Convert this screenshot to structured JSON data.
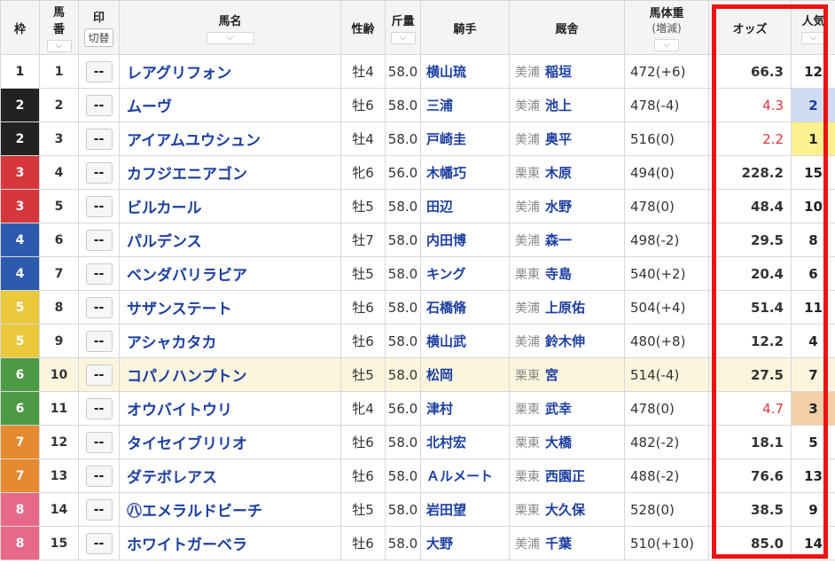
{
  "headers": {
    "waku": "枠",
    "umaban_l1": "馬",
    "umaban_l2": "番",
    "mark": "印",
    "mark_toggle": "切替",
    "name": "馬名",
    "sexage": "性齢",
    "kinryo": "斤量",
    "jockey": "騎手",
    "stable": "厩舎",
    "weight_l1": "馬体重",
    "weight_l2": "(増減)",
    "odds": "オッズ",
    "popularity": "人気"
  },
  "mark_placeholder": "--",
  "rows": [
    {
      "waku": "1",
      "umaban": "1",
      "name": "レアグリフォン",
      "sexage": "牡4",
      "kinryo": "58.0",
      "jockey": "横山琉",
      "region": "美浦",
      "trainer": "稲垣",
      "weight": "472(+6)",
      "odds": "66.3",
      "pop": "12"
    },
    {
      "waku": "2",
      "umaban": "2",
      "name": "ムーヴ",
      "sexage": "牡6",
      "kinryo": "58.0",
      "jockey": "三浦",
      "region": "美浦",
      "trainer": "池上",
      "weight": "478(-4)",
      "odds": "4.3",
      "pop": "2"
    },
    {
      "waku": "2",
      "umaban": "3",
      "name": "アイアムユウシュン",
      "sexage": "牡4",
      "kinryo": "58.0",
      "jockey": "戸崎圭",
      "region": "美浦",
      "trainer": "奥平",
      "weight": "516(0)",
      "odds": "2.2",
      "pop": "1"
    },
    {
      "waku": "3",
      "umaban": "4",
      "name": "カフジエニアゴン",
      "sexage": "牝6",
      "kinryo": "56.0",
      "jockey": "木幡巧",
      "region": "栗東",
      "trainer": "木原",
      "weight": "494(0)",
      "odds": "228.2",
      "pop": "15"
    },
    {
      "waku": "3",
      "umaban": "5",
      "name": "ビルカール",
      "sexage": "牡5",
      "kinryo": "58.0",
      "jockey": "田辺",
      "region": "美浦",
      "trainer": "水野",
      "weight": "478(0)",
      "odds": "48.4",
      "pop": "10"
    },
    {
      "waku": "4",
      "umaban": "6",
      "name": "パルデンス",
      "sexage": "牡7",
      "kinryo": "58.0",
      "jockey": "内田博",
      "region": "美浦",
      "trainer": "森一",
      "weight": "498(-2)",
      "odds": "29.5",
      "pop": "8"
    },
    {
      "waku": "4",
      "umaban": "7",
      "name": "ベンダバリラビア",
      "sexage": "牡5",
      "kinryo": "58.0",
      "jockey": "キング",
      "region": "栗東",
      "trainer": "寺島",
      "weight": "540(+2)",
      "odds": "20.4",
      "pop": "6"
    },
    {
      "waku": "5",
      "umaban": "8",
      "name": "サザンステート",
      "sexage": "牡6",
      "kinryo": "58.0",
      "jockey": "石橋脩",
      "region": "美浦",
      "trainer": "上原佑",
      "weight": "504(+4)",
      "odds": "51.4",
      "pop": "11"
    },
    {
      "waku": "5",
      "umaban": "9",
      "name": "アシャカタカ",
      "sexage": "牡6",
      "kinryo": "58.0",
      "jockey": "横山武",
      "region": "美浦",
      "trainer": "鈴木伸",
      "weight": "480(+8)",
      "odds": "12.2",
      "pop": "4"
    },
    {
      "waku": "6",
      "umaban": "10",
      "name": "コパノハンプトン",
      "sexage": "牡5",
      "kinryo": "58.0",
      "jockey": "松岡",
      "region": "栗東",
      "trainer": "宮",
      "weight": "514(-4)",
      "odds": "27.5",
      "pop": "7"
    },
    {
      "waku": "6",
      "umaban": "11",
      "name": "オウバイトウリ",
      "sexage": "牝4",
      "kinryo": "56.0",
      "jockey": "津村",
      "region": "栗東",
      "trainer": "武幸",
      "weight": "478(0)",
      "odds": "4.7",
      "pop": "3"
    },
    {
      "waku": "7",
      "umaban": "12",
      "name": "タイセイブリリオ",
      "sexage": "牡6",
      "kinryo": "58.0",
      "jockey": "北村宏",
      "region": "栗東",
      "trainer": "大橋",
      "weight": "482(-2)",
      "odds": "18.1",
      "pop": "5"
    },
    {
      "waku": "7",
      "umaban": "13",
      "name": "ダテボレアス",
      "sexage": "牡6",
      "kinryo": "58.0",
      "jockey": "Ａルメート",
      "region": "栗東",
      "trainer": "西園正",
      "weight": "488(-2)",
      "odds": "76.6",
      "pop": "13"
    },
    {
      "waku": "8",
      "umaban": "14",
      "name": "㊇エメラルドビーチ",
      "sexage": "牡5",
      "kinryo": "58.0",
      "jockey": "岩田望",
      "region": "栗東",
      "trainer": "大久保",
      "weight": "528(0)",
      "odds": "38.5",
      "pop": "9"
    },
    {
      "waku": "8",
      "umaban": "15",
      "name": "ホワイトガーベラ",
      "sexage": "牡6",
      "kinryo": "58.0",
      "jockey": "大野",
      "region": "美浦",
      "trainer": "千葉",
      "weight": "510(+10)",
      "odds": "85.0",
      "pop": "14"
    }
  ]
}
